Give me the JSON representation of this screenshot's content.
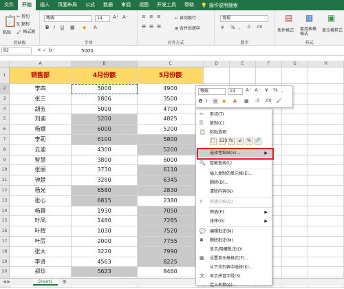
{
  "tabs": [
    "文件",
    "开始",
    "插入",
    "页面布局",
    "公式",
    "数据",
    "审阅",
    "视图",
    "开发工具",
    "帮助"
  ],
  "tell_me": "操作说明搜索",
  "ribbon": {
    "clipboard": {
      "paste": "粘贴",
      "cut": "剪切",
      "copy": "复制",
      "format_painter": "格式刷",
      "label": "剪贴板"
    },
    "font": {
      "name": "等线",
      "size": "14",
      "label": "字体"
    },
    "alignment": {
      "wrap": "自动换行",
      "merge": "合并后居中",
      "label": "对齐方式"
    },
    "number": {
      "format": "常规",
      "label": "数字"
    },
    "styles": {
      "conditional": "条件格式",
      "table": "套用表格格式",
      "cell": "单元格样式",
      "label": "样式"
    }
  },
  "formula_bar": {
    "name_box": "B2",
    "value": "5000"
  },
  "columns": [
    "A",
    "B",
    "C",
    "D",
    "E",
    "F",
    "G",
    "H"
  ],
  "rows": [
    "1",
    "2",
    "3",
    "4",
    "5",
    "6",
    "7",
    "8",
    "9",
    "10",
    "11",
    "12",
    "13",
    "14",
    "15",
    "16",
    "17",
    "18",
    "19",
    "20",
    "21"
  ],
  "table": {
    "headers": [
      "销售部",
      "4月份额",
      "5月份额"
    ],
    "data": [
      [
        "李四",
        "5000",
        "4900"
      ],
      [
        "张三",
        "1806",
        "3500"
      ],
      [
        "胡五",
        "5000",
        "4700"
      ],
      [
        "刘迪",
        "5200",
        "4825"
      ],
      [
        "杨娜",
        "6000",
        "5200"
      ],
      [
        "李莉",
        "6100",
        "5800"
      ],
      [
        "云迪",
        "4300",
        "5200"
      ],
      [
        "智慧",
        "3800",
        "6000"
      ],
      [
        "张丽",
        "3730",
        "6110"
      ],
      [
        "钟楚",
        "3280",
        "6345"
      ],
      [
        "杨光",
        "6580",
        "2830"
      ],
      [
        "张心",
        "6815",
        "2380"
      ],
      [
        "杨霖",
        "1930",
        "7050"
      ],
      [
        "叶凤",
        "1480",
        "7285"
      ],
      [
        "叶辉",
        "1030",
        "7520"
      ],
      [
        "叶厉",
        "2000",
        "7755"
      ],
      [
        "张大",
        "3220",
        "7990"
      ],
      [
        "李贤",
        "4563",
        "8225"
      ],
      [
        "郑珍",
        "5623",
        "8460"
      ]
    ]
  },
  "mini_toolbar": {
    "font": "等线",
    "size": "14"
  },
  "context_menu": {
    "items": [
      "剪切(T)",
      "复制(C)",
      "粘贴选项:",
      "选择性粘贴(S)...",
      "智能查找(L)",
      "插入复制的单元格(E)...",
      "删除(D)...",
      "清除内容(N)",
      "快速分析(Q)",
      "筛选(E)",
      "排序(O)",
      "编辑批注(M)",
      "删除批注(M)",
      "显示/隐藏批注(O)",
      "设置单元格格式(F)...",
      "从下拉列表中选择(K)...",
      "显示拼音字段(S)",
      "定义名称(A)..."
    ]
  },
  "sheet": {
    "tab": "Sheet1"
  }
}
